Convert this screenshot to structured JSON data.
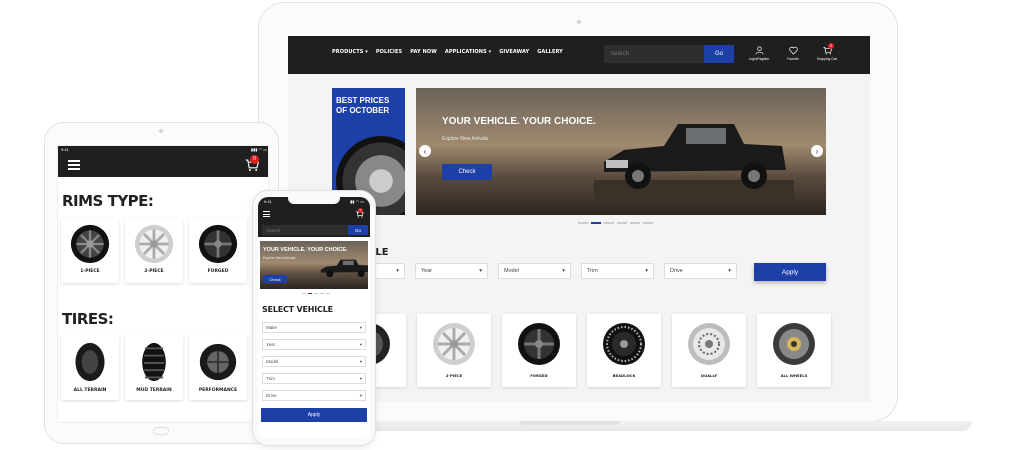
{
  "laptop": {
    "nav_links": [
      "PRODUCTS ▾",
      "POLICIES",
      "PAY NOW",
      "APPLICATIONS ▾",
      "GIVEAWAY",
      "GALLERY"
    ],
    "search_placeholder": "Search",
    "search_button": "Go",
    "icons": [
      {
        "icon": "user-icon",
        "label": "Login/Register"
      },
      {
        "icon": "heart-icon",
        "label": "Favorite"
      },
      {
        "icon": "cart-icon",
        "label": "Shopping Cart",
        "badge": "0"
      }
    ],
    "promo_title": "BEST PRICES OF OCTOBER",
    "hero": {
      "title": "YOUR VEHICLE. YOUR CHOICE.",
      "subtitle": "Explore New Arrivals",
      "button": "Check"
    },
    "select_title": "CLE",
    "filters": [
      "",
      "Year",
      "Model",
      "Trim",
      "Drive"
    ],
    "apply": "Apply",
    "categories": [
      "",
      "2-PIECE",
      "FORGED",
      "BEADLOCK",
      "DUALLY",
      "ALL WHEELS"
    ]
  },
  "tablet": {
    "time": "9:41",
    "cart_badge": "0",
    "rims_title": "RIMS TYPE:",
    "rims": [
      "1-PIECE",
      "2-PIECE",
      "FORGED"
    ],
    "tires_title": "TIRES:",
    "tires": [
      "ALL TERRAIN",
      "MUD TERRAIN",
      "PERFORMANCE"
    ]
  },
  "phone": {
    "time": "9:41",
    "cart_badge": "0",
    "search_placeholder": "Search",
    "search_button": "Go",
    "hero": {
      "title": "YOUR VEHICLE. YOUR CHOICE.",
      "subtitle": "Explore New Arrivals",
      "button": "Check"
    },
    "select_title": "SELECT VEHICLE",
    "filters": [
      "Make",
      "Year",
      "Model",
      "Trim",
      "Drive"
    ],
    "apply": "Apply"
  },
  "colors": {
    "accent": "#1d3fa8",
    "dark": "#1f1f1f",
    "badge": "#e02020"
  }
}
